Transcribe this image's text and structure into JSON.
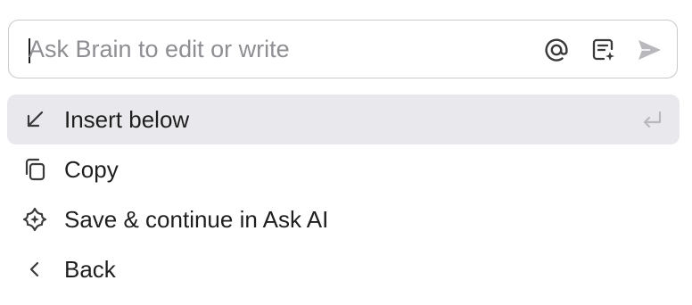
{
  "ask_bar": {
    "placeholder": "Ask Brain to edit or write",
    "value": "",
    "icons": [
      "at-mention-icon",
      "template-sparkle-icon",
      "send-icon"
    ]
  },
  "menu": {
    "items": [
      {
        "label": "Insert below",
        "icon": "arrow-down-left-icon",
        "shortcut_icon": "enter-key-icon",
        "highlighted": true
      },
      {
        "label": "Copy",
        "icon": "copy-icon",
        "highlighted": false
      },
      {
        "label": "Save & continue in Ask AI",
        "icon": "ai-sparkle-icon",
        "highlighted": false
      },
      {
        "label": "Back",
        "icon": "chevron-left-icon",
        "highlighted": false
      }
    ]
  },
  "colors": {
    "highlight_bg": "#e9e8ec",
    "border": "#c9c9ce",
    "text": "#1f1f1f",
    "placeholder": "#8e8e93",
    "icon": "#3a3a3c",
    "muted_icon": "#b8b8bd"
  }
}
